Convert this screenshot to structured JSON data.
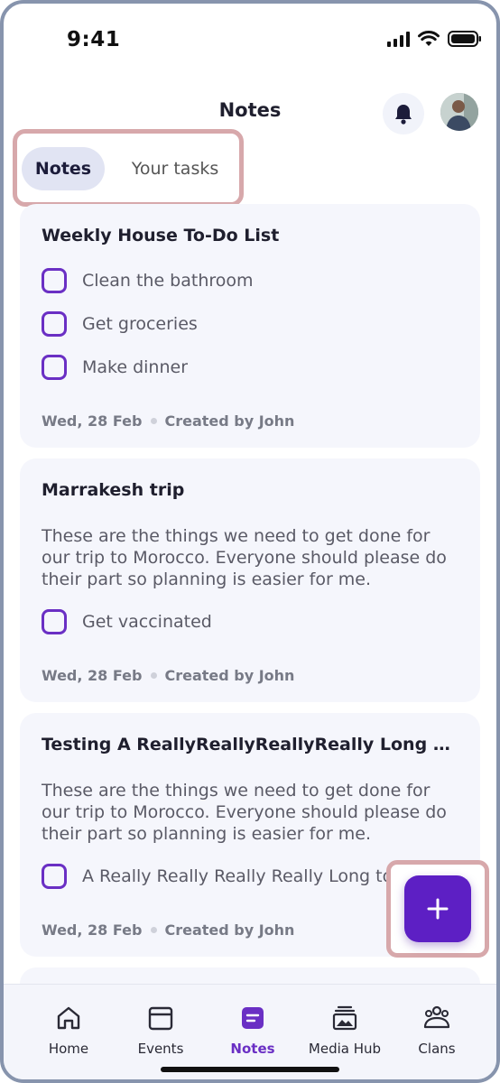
{
  "status_bar": {
    "time": "9:41"
  },
  "header": {
    "title": "Notes"
  },
  "tabs": [
    {
      "label": "Notes",
      "active": true
    },
    {
      "label": "Your tasks",
      "active": false
    }
  ],
  "notes": [
    {
      "title": "Weekly House To-Do List",
      "body": "",
      "tasks": [
        "Clean the bathroom",
        "Get groceries",
        "Make dinner"
      ],
      "date": "Wed, 28 Feb",
      "creator": "Created by John"
    },
    {
      "title": "Marrakesh trip",
      "body": "These are the things we need to get done for our trip to Morocco. Everyone should please do their part so planning is easier for me.",
      "tasks": [
        "Get vaccinated"
      ],
      "date": "Wed, 28 Feb",
      "creator": "Created by John"
    },
    {
      "title": "Testing A ReallyReallyReallyReally Long Na...",
      "body": "These are the things we need to get done for our trip to Morocco. Everyone should please do their part so planning is easier for me.",
      "tasks": [
        "A Really Really Really Really Long to do"
      ],
      "date": "Wed, 28 Feb",
      "creator": "Created by John"
    }
  ],
  "fab": {
    "icon": "plus-icon",
    "color": "#5d1fc4"
  },
  "bottom_nav": [
    {
      "label": "Home",
      "icon": "home-icon"
    },
    {
      "label": "Events",
      "icon": "calendar-icon"
    },
    {
      "label": "Notes",
      "icon": "notes-icon",
      "active": true
    },
    {
      "label": "Media Hub",
      "icon": "media-hub-icon"
    },
    {
      "label": "Clans",
      "icon": "clans-icon"
    }
  ],
  "colors": {
    "accent": "#6a2fc4",
    "card_bg": "#f5f6fc",
    "highlight": "#d7a8ab"
  }
}
